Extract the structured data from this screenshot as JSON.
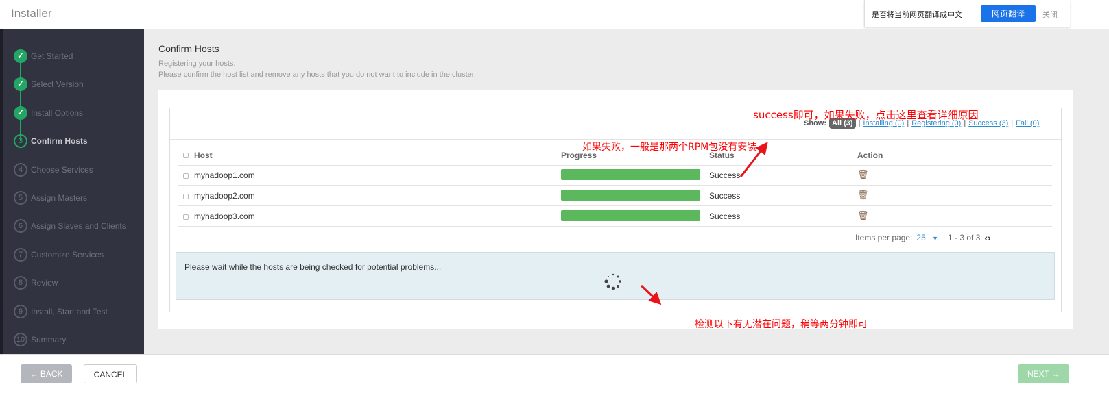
{
  "app": {
    "title": "Installer"
  },
  "translate_bar": {
    "question": "是否将当前网页翻译成中文",
    "translate_button": "网页翻译",
    "close": "关闭"
  },
  "sidebar": {
    "steps": [
      {
        "num": "1",
        "label": "Get Started",
        "state": "done"
      },
      {
        "num": "2",
        "label": "Select Version",
        "state": "done"
      },
      {
        "num": "3",
        "label": "Install Options",
        "state": "done"
      },
      {
        "num": "3",
        "label": "Confirm Hosts",
        "state": "current"
      },
      {
        "num": "4",
        "label": "Choose Services",
        "state": "todo"
      },
      {
        "num": "5",
        "label": "Assign Masters",
        "state": "todo"
      },
      {
        "num": "6",
        "label": "Assign Slaves and Clients",
        "state": "todo"
      },
      {
        "num": "7",
        "label": "Customize Services",
        "state": "todo"
      },
      {
        "num": "8",
        "label": "Review",
        "state": "todo"
      },
      {
        "num": "9",
        "label": "Install, Start and Test",
        "state": "todo"
      },
      {
        "num": "10",
        "label": "Summary",
        "state": "todo"
      }
    ]
  },
  "main": {
    "title": "Confirm Hosts",
    "subtitle1": "Registering your hosts.",
    "subtitle2": "Please confirm the host list and remove any hosts that you do not want to include in the cluster.",
    "filter": {
      "label": "Show:",
      "all": "All (3)",
      "installing": "Installing (0)",
      "registering": "Registering (0)",
      "success": "Success (3)",
      "fail": "Fail (0)"
    },
    "table": {
      "headers": [
        "Host",
        "Progress",
        "Status",
        "Action"
      ],
      "rows": [
        {
          "host": "myhadoop1.com",
          "progress": 100,
          "status": "Success"
        },
        {
          "host": "myhadoop2.com",
          "progress": 100,
          "status": "Success"
        },
        {
          "host": "myhadoop3.com",
          "progress": 100,
          "status": "Success"
        }
      ]
    },
    "pagination": {
      "label": "Items per page:",
      "per_page": "25",
      "range": "1 - 3 of 3"
    },
    "info": "Please wait while the hosts are being checked for potential problems..."
  },
  "annotations": {
    "a1": "如果失败，一般是那两个RPM包没有安装",
    "a2": "success即可，如果失败，点击这里查看详细原因",
    "a3": "检测以下有无潜在问题，稍等两分钟即可"
  },
  "footer": {
    "back": "← BACK",
    "cancel": "CANCEL",
    "next": "NEXT →"
  },
  "colors": {
    "success": "#5cb85c",
    "step_done": "#22a565",
    "annotation": "#ff0000",
    "translate": "#1a73e8"
  }
}
